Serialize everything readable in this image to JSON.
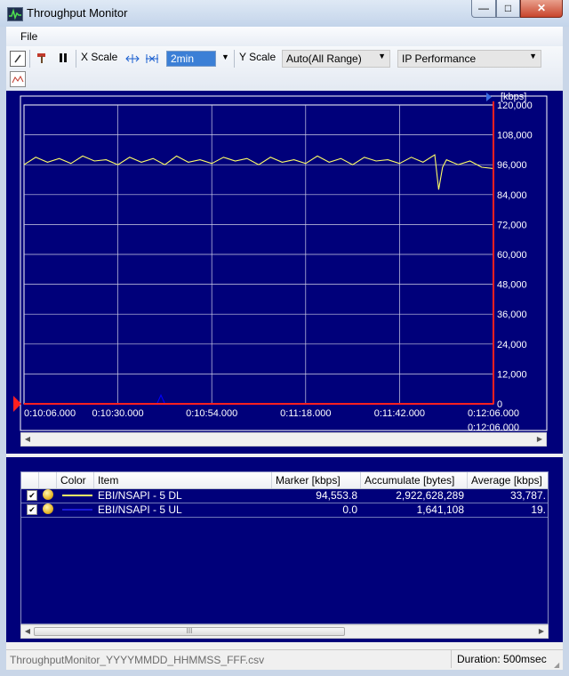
{
  "window": {
    "title": "Throughput Monitor",
    "close_glyph": "✕",
    "min_glyph": "—",
    "max_glyph": "□"
  },
  "menu": {
    "file": "File"
  },
  "toolbar": {
    "x_scale_label": "X Scale",
    "x_scale_value": "2min",
    "y_scale_label": "Y Scale",
    "y_scale_value": "Auto(All Range)",
    "mode_value": "IP Performance"
  },
  "plot": {
    "unit_label": "[kbps]",
    "end_time_label": "0:12:06.000"
  },
  "chart_data": {
    "type": "line",
    "xlabel": "",
    "ylabel": "[kbps]",
    "ylim": [
      0,
      120000
    ],
    "y_ticks": [
      "0",
      "12,000",
      "24,000",
      "36,000",
      "48,000",
      "60,000",
      "72,000",
      "84,000",
      "96,000",
      "108,000",
      "120,000"
    ],
    "x_ticks": [
      "0:10:06.000",
      "0:10:30.000",
      "0:10:54.000",
      "0:11:18.000",
      "0:11:42.000",
      "0:12:06.000"
    ],
    "x_range_seconds": [
      606,
      726
    ],
    "grid": true,
    "series": [
      {
        "name": "EBI/NSAPI - 5 DL",
        "color": "#ffff66",
        "x": [
          606,
          609,
          612,
          615,
          618,
          621,
          624,
          627,
          630,
          633,
          636,
          639,
          642,
          645,
          648,
          651,
          654,
          657,
          660,
          663,
          666,
          669,
          672,
          675,
          678,
          681,
          684,
          687,
          690,
          693,
          696,
          699,
          702,
          705,
          708,
          711,
          712,
          713,
          714,
          717,
          720,
          723,
          726
        ],
        "y": [
          96000,
          99000,
          97000,
          98500,
          96500,
          99500,
          97500,
          98000,
          96000,
          99000,
          97000,
          98500,
          96000,
          99500,
          97000,
          98000,
          96500,
          99000,
          97500,
          98500,
          96000,
          99000,
          97000,
          98000,
          96500,
          99500,
          97000,
          98500,
          96000,
          99000,
          97500,
          98000,
          96500,
          99000,
          97000,
          100000,
          86000,
          95000,
          98000,
          96000,
          97500,
          95000,
          94500
        ]
      },
      {
        "name": "EBI/NSAPI - 5 UL",
        "color": "#0000ff",
        "x": [
          606,
          640,
          641,
          642,
          643,
          726
        ],
        "y": [
          0,
          0,
          3500,
          0,
          0,
          0
        ]
      }
    ]
  },
  "table": {
    "headers": [
      "Color",
      "Item",
      "Marker [kbps]",
      "Accumulate [bytes]",
      "Average [kbps]"
    ],
    "rows": [
      {
        "item": "EBI/NSAPI - 5 DL",
        "marker": "94,553.8",
        "accumulate": "2,922,628,289",
        "average": "33,787.",
        "swatch": "#ffff66"
      },
      {
        "item": "EBI/NSAPI - 5 UL",
        "marker": "0.0",
        "accumulate": "1,641,108",
        "average": "19.",
        "swatch": "#1b1bd6"
      }
    ],
    "check_glyph": "✔",
    "scroll_thumb_glyph": "III"
  },
  "status": {
    "file": "ThroughputMonitor_YYYYMMDD_HHMMSS_FFF.csv",
    "duration": "Duration: 500msec"
  },
  "colors": {
    "plot_bg": "#00007a",
    "grid": "#cfcfe6",
    "marker_red": "#ff2020"
  }
}
